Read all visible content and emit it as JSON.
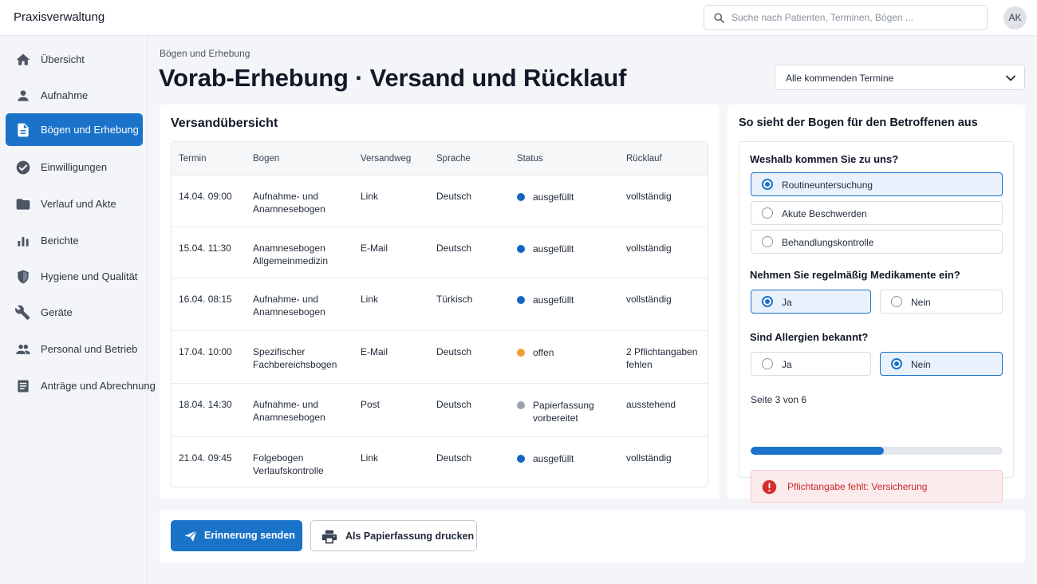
{
  "app": {
    "title": "Praxisverwaltung",
    "avatar_initials": "AK"
  },
  "search": {
    "placeholder": "Suche nach Patienten, Terminen, Bögen ...",
    "value": ""
  },
  "sidebar": {
    "items": [
      {
        "label": "Übersicht",
        "icon": "home-icon",
        "active": false
      },
      {
        "label": "Aufnahme",
        "icon": "person-icon",
        "active": false
      },
      {
        "label": "Bögen und Erhebung",
        "icon": "document-icon",
        "active": true
      },
      {
        "label": "Einwilligungen",
        "icon": "check-circle-icon",
        "active": false
      },
      {
        "label": "Verlauf und Akte",
        "icon": "folder-icon",
        "active": false
      },
      {
        "label": "Berichte",
        "icon": "bar-chart-icon",
        "active": false
      },
      {
        "label": "Hygiene und Qualität",
        "icon": "shield-icon",
        "active": false
      },
      {
        "label": "Geräte",
        "icon": "wrench-icon",
        "active": false
      },
      {
        "label": "Personal und Betrieb",
        "icon": "people-icon",
        "active": false
      },
      {
        "label": "Anträge und Abrechnung",
        "icon": "list-document-icon",
        "active": false
      }
    ]
  },
  "header": {
    "breadcrumb": "Bögen und Erhebung",
    "title": "Vorab-Erhebung · Versand und Rücklauf",
    "filter": {
      "selected": "Alle kommenden Termine"
    }
  },
  "overview": {
    "title": "Versandübersicht",
    "columns": [
      "Termin",
      "Bogen",
      "Versandweg",
      "Sprache",
      "Status",
      "Rücklauf"
    ],
    "rows": [
      {
        "termin": "14.04. 09:00",
        "bogen": [
          "Aufnahme- und",
          "Anamnesebogen"
        ],
        "versandweg": "Link",
        "sprache": "Deutsch",
        "status": [
          "ausgefüllt"
        ],
        "status_color": "#1565c0",
        "ruecklauf": [
          "vollständig"
        ]
      },
      {
        "termin": "15.04. 11:30",
        "bogen": [
          "Anamnesebogen",
          "Allgemeinmedizin"
        ],
        "versandweg": "E-Mail",
        "sprache": "Deutsch",
        "status": [
          "ausgefüllt"
        ],
        "status_color": "#1565c0",
        "ruecklauf": [
          "vollständig"
        ]
      },
      {
        "termin": "16.04. 08:15",
        "bogen": [
          "Aufnahme- und",
          "Anamnesebogen"
        ],
        "versandweg": "Link",
        "sprache": "Türkisch",
        "status": [
          "ausgefüllt"
        ],
        "status_color": "#1565c0",
        "ruecklauf": [
          "vollständig"
        ]
      },
      {
        "termin": "17.04. 10:00",
        "bogen": [
          "Spezifischer",
          "Fachbereichsbogen"
        ],
        "versandweg": "E-Mail",
        "sprache": "Deutsch",
        "status": [
          "offen"
        ],
        "status_color": "#f0a030",
        "ruecklauf": [
          "2 Pflichtangaben",
          "fehlen"
        ]
      },
      {
        "termin": "18.04. 14:30",
        "bogen": [
          "Aufnahme- und",
          "Anamnesebogen"
        ],
        "versandweg": "Post",
        "sprache": "Deutsch",
        "status": [
          "Papierfassung",
          "vorbereitet"
        ],
        "status_color": "#9ca3af",
        "ruecklauf": [
          "ausstehend"
        ]
      },
      {
        "termin": "21.04. 09:45",
        "bogen": [
          "Folgebogen",
          "Verlaufskontrolle"
        ],
        "versandweg": "Link",
        "sprache": "Deutsch",
        "status": [
          "ausgefüllt"
        ],
        "status_color": "#1565c0",
        "ruecklauf": [
          "vollständig"
        ]
      }
    ]
  },
  "preview": {
    "title": "So sieht der Bogen für den Betroffenen aus",
    "questions": [
      {
        "label": "Weshalb kommen Sie zu uns?",
        "layout": "stack",
        "options": [
          {
            "label": "Routineuntersuchung",
            "selected": true
          },
          {
            "label": "Akute Beschwerden",
            "selected": false
          },
          {
            "label": "Behandlungskontrolle",
            "selected": false
          }
        ]
      },
      {
        "label": "Nehmen Sie regelmäßig Medikamente ein?",
        "layout": "row",
        "options": [
          {
            "label": "Ja",
            "selected": true
          },
          {
            "label": "Nein",
            "selected": false
          }
        ]
      },
      {
        "label": "Sind Allergien bekannt?",
        "layout": "row",
        "options": [
          {
            "label": "Ja",
            "selected": false
          },
          {
            "label": "Nein",
            "selected": true
          }
        ]
      }
    ],
    "page_indicator": "Seite 3 von 6",
    "progress_fraction": 0.53,
    "alert": "Pflichtangabe fehlt: Versicherung"
  },
  "actions": {
    "reminder_label": "Erinnerung senden",
    "print_label": "Als Papierfassung drucken"
  },
  "colors": {
    "accent": "#1a73c9",
    "error": "#c62828",
    "warning": "#f0a030"
  }
}
